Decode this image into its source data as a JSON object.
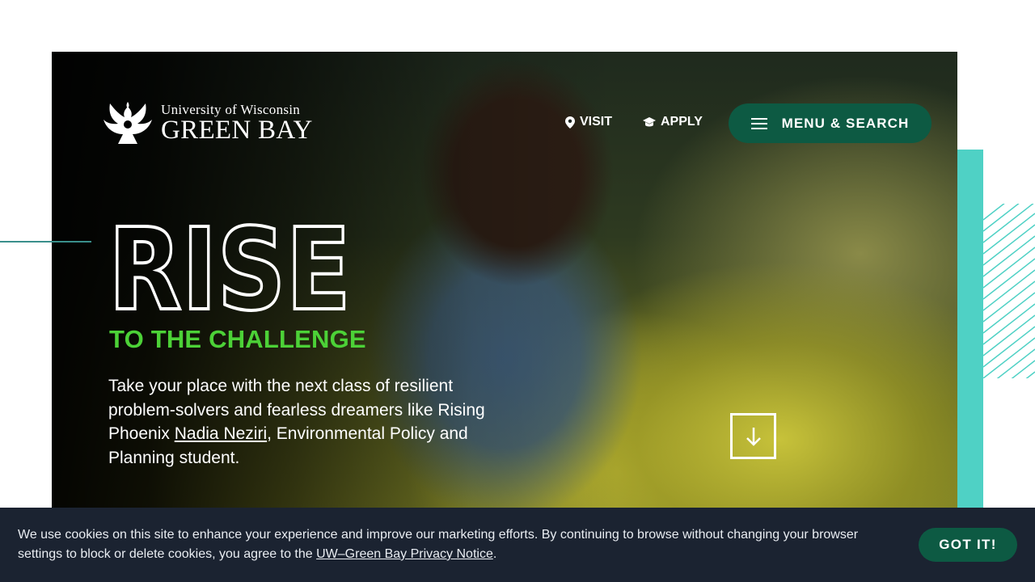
{
  "brand": {
    "small_line": "University of Wisconsin",
    "big_line": "GREEN BAY"
  },
  "nav": {
    "visit_label": "VISIT",
    "apply_label": "APPLY",
    "menu_label": "MENU & SEARCH"
  },
  "hero": {
    "headline": "RISE",
    "subheadline": "TO THE CHALLENGE",
    "intro_before": "Take your place with the next class of resilient problem-solvers and fearless dreamers like Rising Phoenix ",
    "intro_link": "Nadia Neziri",
    "intro_after": ", Environmental Policy and Planning student."
  },
  "cookie": {
    "text_before": "We use cookies on this site to enhance your experience and improve our marketing efforts. By continuing to browse without changing your browser settings to block or delete cookies, you agree to the ",
    "link": "UW–Green Bay Privacy Notice",
    "text_after": ".",
    "button_label": "GOT IT!"
  },
  "icons": {
    "logo": "phoenix-logo",
    "visit": "map-pin-icon",
    "apply": "graduation-cap-icon",
    "menu": "hamburger-icon",
    "scroll": "arrow-down-icon"
  },
  "colors": {
    "brand_green": "#0d5a43",
    "accent_green": "#4cd137",
    "teal": "#4fd1c5",
    "cookie_bg": "#1b2331"
  }
}
